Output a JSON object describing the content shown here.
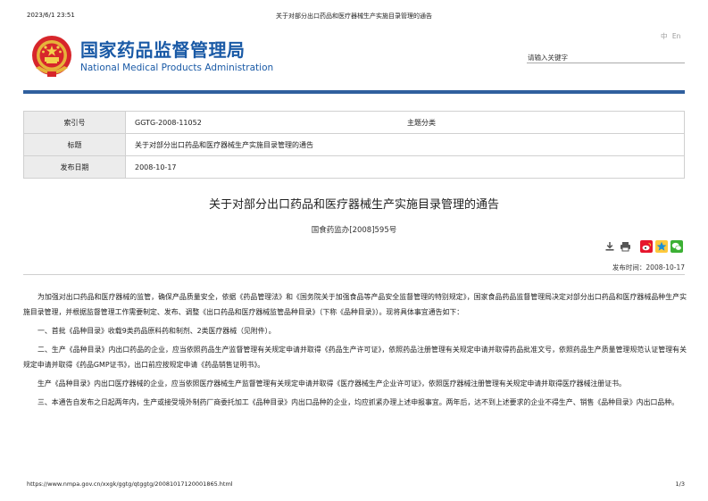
{
  "print_header": {
    "timestamp": "2023/6/1 23:51",
    "title": "关于对部分出口药品和医疗器械生产实施目录管理的通告"
  },
  "site": {
    "name_cn": "国家药品监督管理局",
    "name_en": "National Medical Products Administration",
    "logo_icon": "national-emblem-icon",
    "brand_color": "#1a5aa6",
    "rule_color": "#2f5f9e"
  },
  "lang_switch": {
    "zh": "中",
    "en": "En"
  },
  "search": {
    "placeholder": "请输入关键字"
  },
  "meta": {
    "index_label": "索引号",
    "index_value": "GGTG-2008-11052",
    "category_label": "主题分类",
    "title_label": "标题",
    "title_value": "关于对部分出口药品和医疗器械生产实施目录管理的通告",
    "date_label": "发布日期",
    "date_value": "2008-10-17"
  },
  "article": {
    "title": "关于对部分出口药品和医疗器械生产实施目录管理的通告",
    "doc_number": "国食药监办[2008]595号",
    "publish_time": "发布时间：2008-10-17",
    "tools": [
      "download-icon",
      "print-icon",
      "weibo-icon",
      "qzone-icon",
      "wechat-icon"
    ],
    "paragraphs": [
      "为加强对出口药品和医疗器械的监管，确保产品质量安全，依据《药品管理法》和《国务院关于加强食品等产品安全监督管理的特别规定》，国家食品药品监督管理局决定对部分出口药品和医疗器械品种生产实施目录管理，并根据监督管理工作需要制定、发布、调整《出口药品和医疗器械监管品种目录》（下称《品种目录》）。现将具体事宜通告如下：",
      "一、首批《品种目录》收载9类药品原料药和制剂、2类医疗器械（见附件）。",
      "二、生产《品种目录》内出口药品的企业，应当依照药品生产监督管理有关规定申请并取得《药品生产许可证》，依照药品注册管理有关规定申请并取得药品批准文号，依照药品生产质量管理规范认证管理有关规定申请并取得《药品GMP证书》，出口前应按规定申请《药品销售证明书》。",
      "生产《品种目录》内出口医疗器械的企业，应当依照医疗器械生产监督管理有关规定申请并取得《医疗器械生产企业许可证》，依照医疗器械注册管理有关规定申请并取得医疗器械注册证书。",
      "三、本通告自发布之日起两年内，生产或接受境外制药厂商委托加工《品种目录》内出口品种的企业，均应抓紧办理上述申报事宜。两年后，达不到上述要求的企业不得生产、销售《品种目录》内出口品种。"
    ]
  },
  "print_footer": {
    "url": "https://www.nmpa.gov.cn/xxgk/ggtg/qtggtg/20081017120001865.html",
    "page": "1/3"
  }
}
